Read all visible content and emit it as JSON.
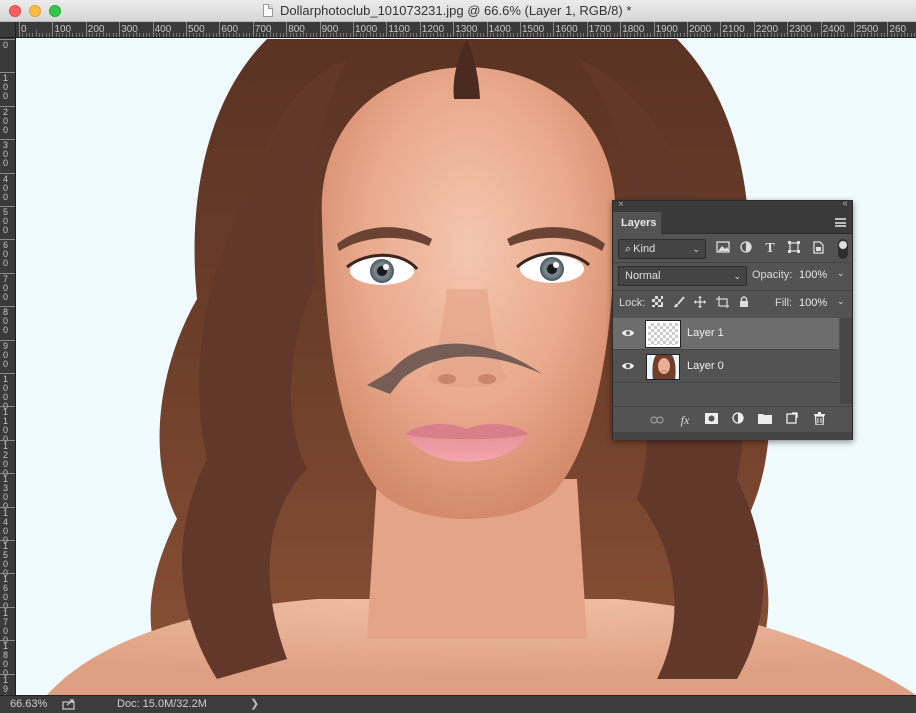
{
  "window": {
    "title": "Dollarphotoclub_101073231.jpg @ 66.6% (Layer 1, RGB/8) *"
  },
  "ruler": {
    "top_labels": [
      "0",
      "100",
      "200",
      "300",
      "400",
      "500",
      "600",
      "700",
      "800",
      "900",
      "1000",
      "1100",
      "1200",
      "1300",
      "1400",
      "1500",
      "1600",
      "1700",
      "1800",
      "1900",
      "2000",
      "2100",
      "2200",
      "2300",
      "2400",
      "2500",
      "260"
    ],
    "left_labels": [
      "0",
      "100",
      "200",
      "300",
      "400",
      "500",
      "600",
      "700",
      "800",
      "900",
      "1000",
      "1100",
      "1200",
      "1300",
      "1400",
      "1500",
      "1600",
      "1700",
      "1800",
      "1900"
    ]
  },
  "status": {
    "zoom": "66.63%",
    "doc": "Doc: 15.0M/32.2M",
    "arrow": "❯"
  },
  "layers_panel": {
    "close": "×",
    "collapse": "‹‹",
    "tab": "Layers",
    "kind": "Kind",
    "filter_icons": [
      "image-filter-icon",
      "adjustment-filter-icon",
      "type-filter-icon",
      "shape-filter-icon",
      "smart-object-filter-icon"
    ],
    "blend_mode": "Normal",
    "opacity_label": "Opacity:",
    "opacity_value": "100%",
    "lock_label": "Lock:",
    "fill_label": "Fill:",
    "fill_value": "100%",
    "layers": [
      {
        "name": "Layer 1",
        "selected": true,
        "visible": true,
        "thumb": "transparent"
      },
      {
        "name": "Layer 0",
        "selected": false,
        "visible": true,
        "thumb": "photo"
      }
    ],
    "footer_icons": [
      "link-layers-icon",
      "fx-icon",
      "add-mask-icon",
      "adjustment-layer-icon",
      "new-group-icon",
      "new-layer-icon",
      "trash-icon"
    ],
    "fx_text": "fx"
  },
  "colors": {
    "panel_bg": "#535353",
    "selected_row": "#6d6d6d",
    "canvas_bg": "#f0fbff",
    "stroke": "#6b5750"
  }
}
